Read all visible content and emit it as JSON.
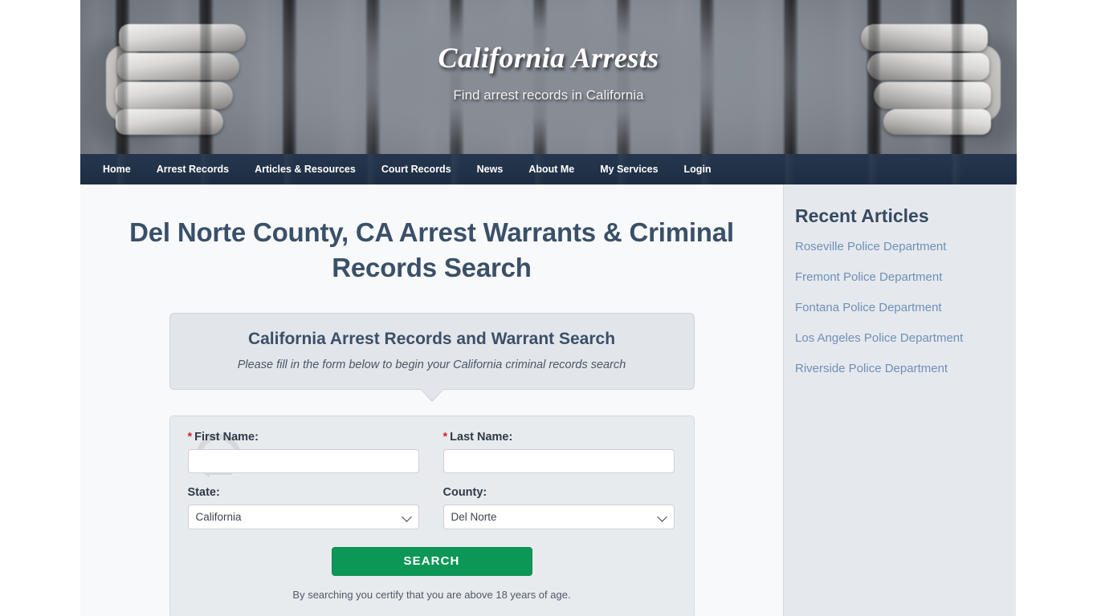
{
  "site": {
    "title": "California Arrests",
    "tagline": "Find arrest records in California"
  },
  "nav": {
    "items": [
      {
        "label": "Home",
        "name": "home"
      },
      {
        "label": "Arrest Records",
        "name": "arrest-records"
      },
      {
        "label": "Articles & Resources",
        "name": "articles-resources"
      },
      {
        "label": "Court Records",
        "name": "court-records"
      },
      {
        "label": "News",
        "name": "news"
      },
      {
        "label": "About Me",
        "name": "about-me"
      },
      {
        "label": "My Services",
        "name": "my-services"
      },
      {
        "label": "Login",
        "name": "login"
      }
    ]
  },
  "main": {
    "page_title": "Del Norte County, CA Arrest Warrants & Criminal Records Search",
    "callout": {
      "heading": "California Arrest Records and Warrant Search",
      "subtext": "Please fill in the form below to begin your California criminal records search"
    },
    "form": {
      "first_name": {
        "label": "First Name:",
        "required_mark": "*",
        "value": "",
        "placeholder": ""
      },
      "last_name": {
        "label": "Last Name:",
        "required_mark": "*",
        "value": "",
        "placeholder": ""
      },
      "state": {
        "label": "State:",
        "selected": "California"
      },
      "county": {
        "label": "County:",
        "selected": "Del Norte"
      },
      "search_button": "SEARCH",
      "disclaimer": "By searching you certify that you are above 18 years of age."
    }
  },
  "sidebar": {
    "title": "Recent Articles",
    "links": [
      "Roseville Police Department",
      "Fremont Police Department",
      "Fontana Police Department",
      "Los Angeles Police Department",
      "Riverside Police Department"
    ]
  },
  "colors": {
    "nav_bg": "#22334a",
    "heading": "#3a5069",
    "accent_green": "#0d9757",
    "link_blue": "#6f8fb5",
    "required_red": "#d9232d",
    "sidebar_bg": "#e5e9ee",
    "main_bg": "#f8f9fa"
  }
}
